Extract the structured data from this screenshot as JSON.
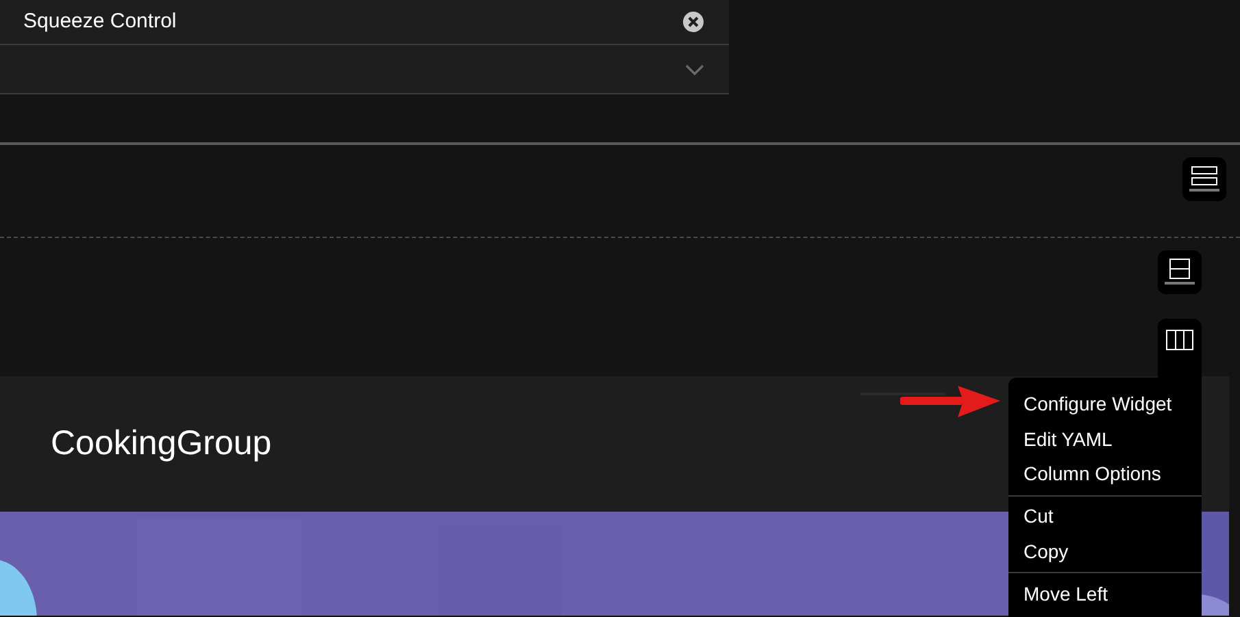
{
  "filter_panel": {
    "chip": {
      "label": "Squeeze Control"
    }
  },
  "card": {
    "title": "CookingGroup"
  },
  "context_menu": {
    "groups": [
      [
        {
          "label": "Configure Widget"
        },
        {
          "label": "Edit YAML"
        },
        {
          "label": "Column Options"
        }
      ],
      [
        {
          "label": "Cut"
        },
        {
          "label": "Copy"
        }
      ],
      [
        {
          "label": "Move Left"
        }
      ]
    ]
  }
}
